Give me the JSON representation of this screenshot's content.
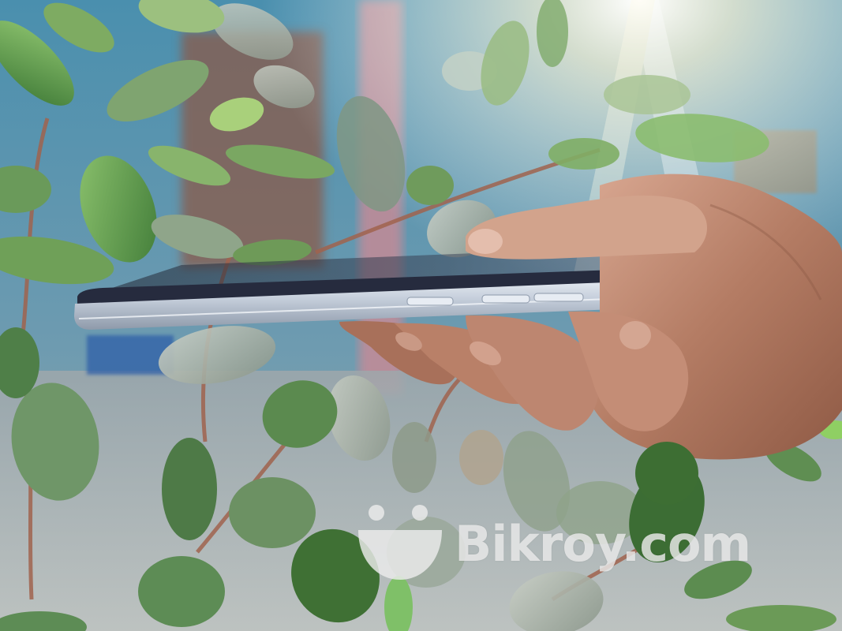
{
  "image": {
    "watermark": {
      "text": "Bikroy.com",
      "icon": "bikroy-logo-icon"
    },
    "colors": {
      "wall": "#4c8fa8",
      "leaf": "#5c9a4a",
      "phone_frame": "#c9d2de",
      "skin": "#b9826a"
    }
  }
}
